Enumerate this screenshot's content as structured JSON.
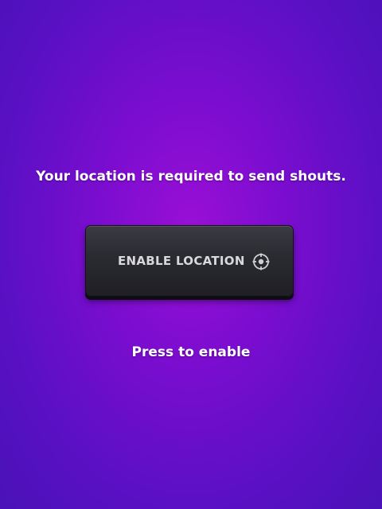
{
  "screen": {
    "prompt_text": "Your location is required to send shouts.",
    "hint_text": "Press to enable"
  },
  "enable_button": {
    "label": "ENABLE LOCATION",
    "icon": "gps-target-icon"
  },
  "colors": {
    "background_center": "#9a0fd6",
    "background_edge": "#4a12b8",
    "button_face": "#2a2a31",
    "button_text": "#d9d9dc",
    "text": "#ffffff"
  }
}
